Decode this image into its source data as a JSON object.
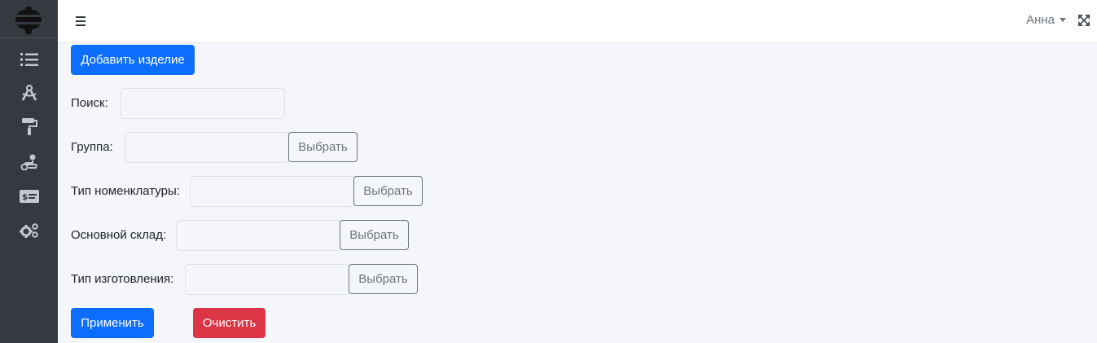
{
  "sidebar": {
    "logo_icon": "app-logo-icon",
    "items": [
      {
        "icon": "list-icon"
      },
      {
        "icon": "compass-tools-icon"
      },
      {
        "icon": "paint-roller-icon"
      },
      {
        "icon": "route-icon"
      },
      {
        "icon": "money-check-icon"
      },
      {
        "icon": "cogs-icon"
      }
    ]
  },
  "topbar": {
    "menu_icon": "hamburger-icon",
    "user_name": "Анна",
    "fullscreen_icon": "expand-arrows-icon"
  },
  "main": {
    "add_button": "Добавить изделие",
    "filters": {
      "search_label": "Поиск:",
      "search_value": "",
      "group_label": "Группа:",
      "group_value": "",
      "nomenclature_label": "Тип номенклатуры:",
      "nomenclature_value": "",
      "warehouse_label": "Основной склад:",
      "warehouse_value": "",
      "manufacture_label": "Тип изготовления:",
      "manufacture_value": "",
      "select_button": "Выбрать"
    },
    "apply_button": "Применить",
    "clear_button": "Очистить"
  },
  "colors": {
    "primary": "#0d6efd",
    "danger": "#dc3545",
    "sidebar": "#343a40",
    "background": "#f4f6f9"
  }
}
